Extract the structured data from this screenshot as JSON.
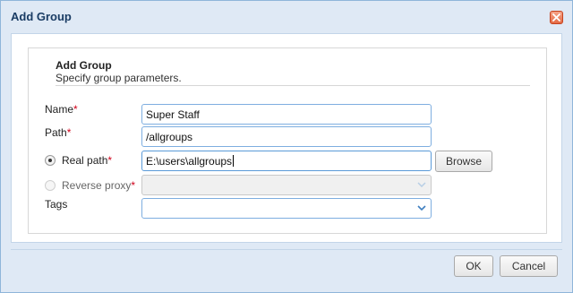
{
  "dialog": {
    "title": "Add Group"
  },
  "group": {
    "title": "Add Group",
    "subtitle": "Specify group parameters."
  },
  "fields": {
    "name": {
      "label": "Name",
      "required": "*",
      "value": "Super Staff"
    },
    "path": {
      "label": "Path",
      "required": "*",
      "value": "/allgroups"
    },
    "real_path": {
      "label": "Real path",
      "required": "*",
      "value": "E:\\users\\allgroups",
      "selected": true
    },
    "reverse_proxy": {
      "label": "Reverse proxy",
      "required": "*",
      "value": "",
      "selected": false
    },
    "tags": {
      "label": "Tags",
      "value": ""
    }
  },
  "buttons": {
    "browse": "Browse",
    "ok": "OK",
    "cancel": "Cancel"
  },
  "icons": {
    "close": "close-icon",
    "dropdown": "chevron-down-icon"
  },
  "colors": {
    "accent": "#7eaee0",
    "required": "#d0021b",
    "title": "#1a3c64",
    "frame": "#dfe9f5"
  }
}
